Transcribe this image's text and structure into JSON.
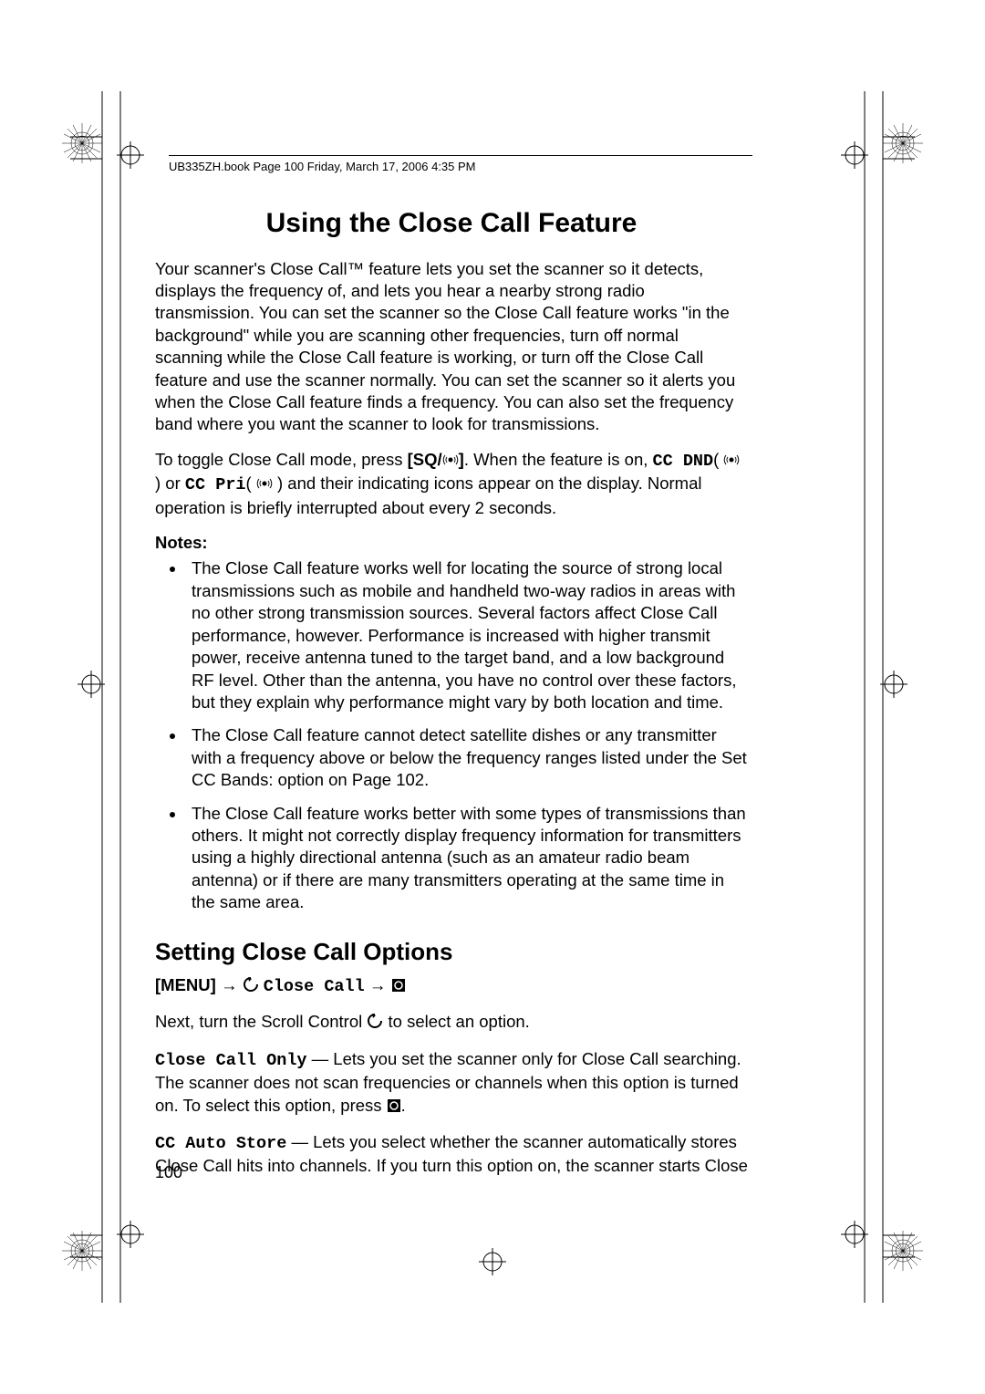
{
  "header": "UB335ZH.book  Page 100  Friday, March 17, 2006  4:35 PM",
  "title": "Using the Close Call Feature",
  "intro": "Your scanner's Close Call™ feature lets you set the scanner so it detects, displays the frequency of, and lets you hear a nearby strong radio transmission. You can set the scanner so the Close Call feature works \"in the background\" while you are scanning other frequencies, turn off normal scanning while the Close Call feature is working, or turn off the Close Call feature and use the scanner normally. You can set the scanner so it alerts you when the Close Call feature finds a frequency. You can also set the frequency band where you want the scanner to look for transmissions.",
  "toggle": {
    "t1": "To toggle Close Call mode, press ",
    "sq": "[SQ/",
    "sq_end": "]",
    "t2": ". When the feature is on, ",
    "cc_dnd": "CC DND",
    "t3": " or ",
    "cc_pri": "CC Pri",
    "t4": " and their indicating icons appear on the display. Normal operation is briefly interrupted about every 2 seconds."
  },
  "notes_label": "Notes:",
  "notes": [
    "The Close Call feature works well for locating the source of strong local transmissions such as mobile and handheld two-way radios in areas with no other strong transmission sources. Several factors affect Close Call performance, however. Performance is increased with higher transmit power, receive antenna tuned to the target band, and a low background RF level. Other than the antenna, you have no control over these factors, but they explain why performance might vary by both location and time.",
    "The Close Call feature cannot detect satellite dishes or any transmitter with a frequency above or below the frequency ranges listed under the Set CC Bands: option on Page 102.",
    "The Close Call feature works better with some types of transmissions than others. It might not correctly display frequency information for transmitters using a highly directional antenna (such as an amateur radio beam antenna) or if there are many transmitters operating at the same time in the same area."
  ],
  "subtitle": "Setting Close Call Options",
  "menu": {
    "label": "[MENU]",
    "arrow": "→",
    "close_call": "Close Call"
  },
  "next_line": {
    "t1": "Next, turn the Scroll Control ",
    "t2": " to select an option."
  },
  "close_call_only": {
    "label": "Close Call Only",
    "desc_a": " — Lets you set the scanner only for Close Call searching. The scanner does not scan frequencies or channels when this option is turned on. To select this option, press ",
    "desc_b": "."
  },
  "cc_auto_store": {
    "label": "CC Auto Store",
    "desc": " — Lets you select whether the scanner automatically stores Close Call hits into channels. If you turn this option on, the scanner starts Close"
  },
  "page_number": "100"
}
